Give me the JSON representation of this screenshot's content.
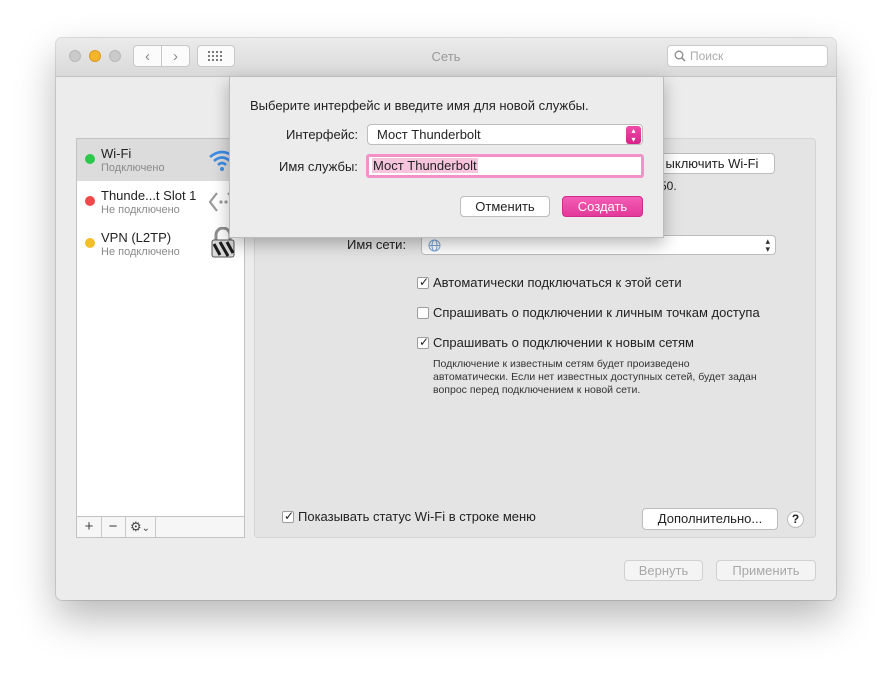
{
  "window": {
    "title": "Сеть",
    "search_placeholder": "Поиск",
    "traffic_lights": [
      "#c9c9c9",
      "#f5b429",
      "#c9c9c9"
    ]
  },
  "sidebar": {
    "items": [
      {
        "name": "Wi-Fi",
        "status": "Подключено",
        "dot_color": "#2cc84a",
        "icon": "wifi-icon"
      },
      {
        "name": "Thunde...t Slot  1",
        "status": "Не подключено",
        "dot_color": "#f0484b",
        "icon": "thunderbolt-bridge-icon"
      },
      {
        "name": "VPN (L2TP)",
        "status": "Не подключено",
        "dot_color": "#f4bd2b",
        "icon": "vpn-lock-icon"
      }
    ],
    "toolbar": {
      "add": "+",
      "remove": "−",
      "gear": "⚙",
      "gear_caret": "⌄"
    }
  },
  "main": {
    "wifi_toggle_button": "ыключить Wi-Fi",
    "status_fragment": "50.",
    "network_name_label": "Имя сети:",
    "checkboxes": [
      {
        "label": "Автоматически подключаться к этой сети",
        "checked": true
      },
      {
        "label": "Спрашивать о подключении к личным точкам доступа",
        "checked": false
      },
      {
        "label": "Спрашивать о подключении к новым сетям",
        "checked": true
      }
    ],
    "help_text": [
      "Подключение к известным сетям будет произведено",
      "автоматически. Если нет известных доступных сетей, будет задан",
      "вопрос перед подключением к новой сети."
    ],
    "show_status": {
      "label": "Показывать статус Wi-Fi в строке меню",
      "checked": true
    },
    "advanced_button": "Дополнительно...",
    "help_button": "?"
  },
  "footer": {
    "revert_button": "Вернуть",
    "apply_button": "Применить"
  },
  "sheet": {
    "title": "Выберите интерфейс и введите имя для новой службы.",
    "interface_label": "Интерфейс:",
    "interface_value": "Мост Thunderbolt",
    "service_name_label": "Имя службы:",
    "service_name_value": "Мост Thunderbolt",
    "cancel_button": "Отменить",
    "create_button": "Создать",
    "accent_color": "#e8409e"
  }
}
